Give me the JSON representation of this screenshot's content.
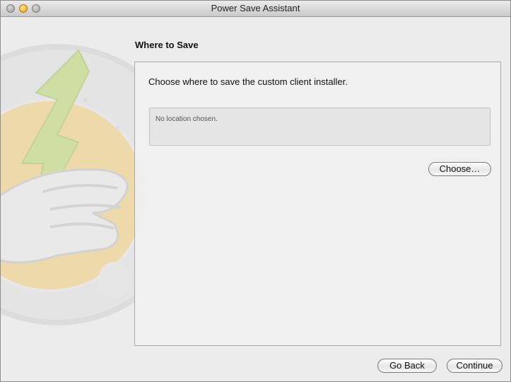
{
  "window": {
    "title": "Power Save Assistant"
  },
  "page": {
    "heading": "Where to Save",
    "prompt": "Choose where to save the custom client installer.",
    "location_text": "No location chosen.",
    "choose_label": "Choose…"
  },
  "footer": {
    "back_label": "Go Back",
    "continue_label": "Continue"
  },
  "colors": {
    "bolt": "#b9d66a",
    "badge": "#f4c25a",
    "window_bg": "#ececec"
  },
  "icons": {
    "window_controls": [
      "close-icon",
      "minimize-icon",
      "zoom-icon"
    ],
    "background_art": "power-save-lightning-hand-icon"
  }
}
